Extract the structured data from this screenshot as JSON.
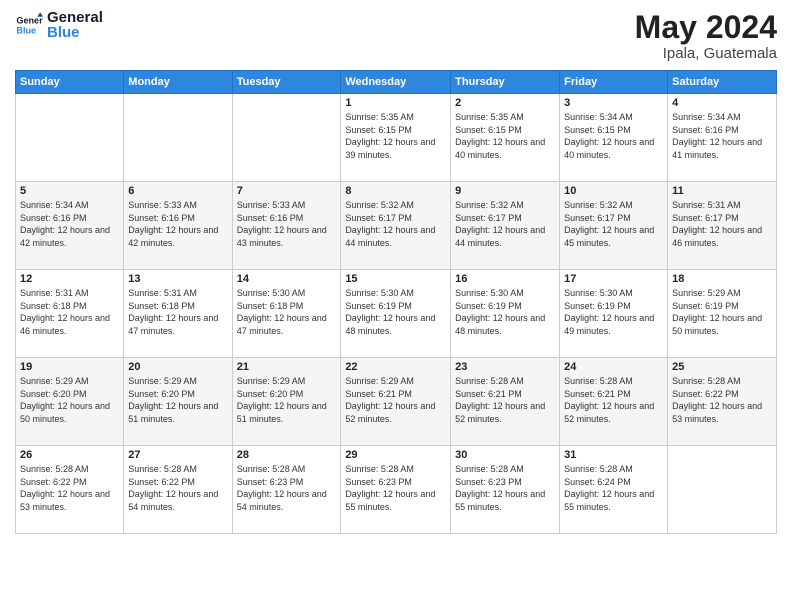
{
  "header": {
    "logo_general": "General",
    "logo_blue": "Blue",
    "month_year": "May 2024",
    "location": "Ipala, Guatemala"
  },
  "weekdays": [
    "Sunday",
    "Monday",
    "Tuesday",
    "Wednesday",
    "Thursday",
    "Friday",
    "Saturday"
  ],
  "weeks": [
    [
      {
        "day": "",
        "info": ""
      },
      {
        "day": "",
        "info": ""
      },
      {
        "day": "",
        "info": ""
      },
      {
        "day": "1",
        "info": "Sunrise: 5:35 AM\nSunset: 6:15 PM\nDaylight: 12 hours\nand 39 minutes."
      },
      {
        "day": "2",
        "info": "Sunrise: 5:35 AM\nSunset: 6:15 PM\nDaylight: 12 hours\nand 40 minutes."
      },
      {
        "day": "3",
        "info": "Sunrise: 5:34 AM\nSunset: 6:15 PM\nDaylight: 12 hours\nand 40 minutes."
      },
      {
        "day": "4",
        "info": "Sunrise: 5:34 AM\nSunset: 6:16 PM\nDaylight: 12 hours\nand 41 minutes."
      }
    ],
    [
      {
        "day": "5",
        "info": "Sunrise: 5:34 AM\nSunset: 6:16 PM\nDaylight: 12 hours\nand 42 minutes."
      },
      {
        "day": "6",
        "info": "Sunrise: 5:33 AM\nSunset: 6:16 PM\nDaylight: 12 hours\nand 42 minutes."
      },
      {
        "day": "7",
        "info": "Sunrise: 5:33 AM\nSunset: 6:16 PM\nDaylight: 12 hours\nand 43 minutes."
      },
      {
        "day": "8",
        "info": "Sunrise: 5:32 AM\nSunset: 6:17 PM\nDaylight: 12 hours\nand 44 minutes."
      },
      {
        "day": "9",
        "info": "Sunrise: 5:32 AM\nSunset: 6:17 PM\nDaylight: 12 hours\nand 44 minutes."
      },
      {
        "day": "10",
        "info": "Sunrise: 5:32 AM\nSunset: 6:17 PM\nDaylight: 12 hours\nand 45 minutes."
      },
      {
        "day": "11",
        "info": "Sunrise: 5:31 AM\nSunset: 6:17 PM\nDaylight: 12 hours\nand 46 minutes."
      }
    ],
    [
      {
        "day": "12",
        "info": "Sunrise: 5:31 AM\nSunset: 6:18 PM\nDaylight: 12 hours\nand 46 minutes."
      },
      {
        "day": "13",
        "info": "Sunrise: 5:31 AM\nSunset: 6:18 PM\nDaylight: 12 hours\nand 47 minutes."
      },
      {
        "day": "14",
        "info": "Sunrise: 5:30 AM\nSunset: 6:18 PM\nDaylight: 12 hours\nand 47 minutes."
      },
      {
        "day": "15",
        "info": "Sunrise: 5:30 AM\nSunset: 6:19 PM\nDaylight: 12 hours\nand 48 minutes."
      },
      {
        "day": "16",
        "info": "Sunrise: 5:30 AM\nSunset: 6:19 PM\nDaylight: 12 hours\nand 48 minutes."
      },
      {
        "day": "17",
        "info": "Sunrise: 5:30 AM\nSunset: 6:19 PM\nDaylight: 12 hours\nand 49 minutes."
      },
      {
        "day": "18",
        "info": "Sunrise: 5:29 AM\nSunset: 6:19 PM\nDaylight: 12 hours\nand 50 minutes."
      }
    ],
    [
      {
        "day": "19",
        "info": "Sunrise: 5:29 AM\nSunset: 6:20 PM\nDaylight: 12 hours\nand 50 minutes."
      },
      {
        "day": "20",
        "info": "Sunrise: 5:29 AM\nSunset: 6:20 PM\nDaylight: 12 hours\nand 51 minutes."
      },
      {
        "day": "21",
        "info": "Sunrise: 5:29 AM\nSunset: 6:20 PM\nDaylight: 12 hours\nand 51 minutes."
      },
      {
        "day": "22",
        "info": "Sunrise: 5:29 AM\nSunset: 6:21 PM\nDaylight: 12 hours\nand 52 minutes."
      },
      {
        "day": "23",
        "info": "Sunrise: 5:28 AM\nSunset: 6:21 PM\nDaylight: 12 hours\nand 52 minutes."
      },
      {
        "day": "24",
        "info": "Sunrise: 5:28 AM\nSunset: 6:21 PM\nDaylight: 12 hours\nand 52 minutes."
      },
      {
        "day": "25",
        "info": "Sunrise: 5:28 AM\nSunset: 6:22 PM\nDaylight: 12 hours\nand 53 minutes."
      }
    ],
    [
      {
        "day": "26",
        "info": "Sunrise: 5:28 AM\nSunset: 6:22 PM\nDaylight: 12 hours\nand 53 minutes."
      },
      {
        "day": "27",
        "info": "Sunrise: 5:28 AM\nSunset: 6:22 PM\nDaylight: 12 hours\nand 54 minutes."
      },
      {
        "day": "28",
        "info": "Sunrise: 5:28 AM\nSunset: 6:23 PM\nDaylight: 12 hours\nand 54 minutes."
      },
      {
        "day": "29",
        "info": "Sunrise: 5:28 AM\nSunset: 6:23 PM\nDaylight: 12 hours\nand 55 minutes."
      },
      {
        "day": "30",
        "info": "Sunrise: 5:28 AM\nSunset: 6:23 PM\nDaylight: 12 hours\nand 55 minutes."
      },
      {
        "day": "31",
        "info": "Sunrise: 5:28 AM\nSunset: 6:24 PM\nDaylight: 12 hours\nand 55 minutes."
      },
      {
        "day": "",
        "info": ""
      }
    ]
  ]
}
